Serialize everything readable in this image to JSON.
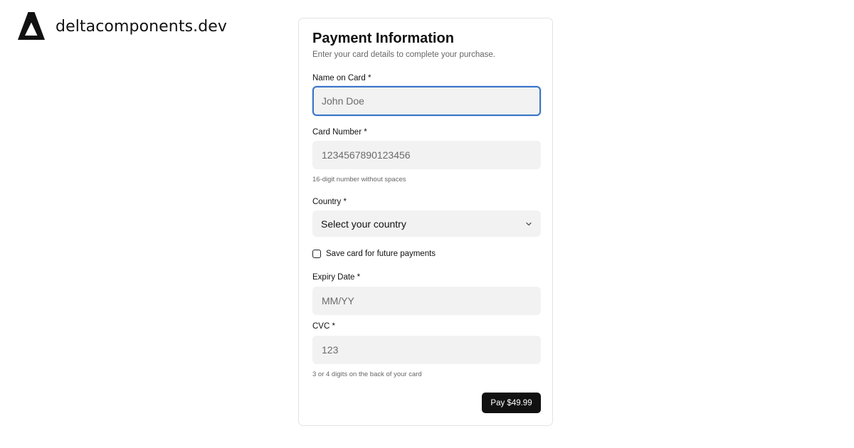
{
  "brand": {
    "name": "deltacomponents.dev",
    "logo_icon": "delta-triangle-icon"
  },
  "form": {
    "title": "Payment Information",
    "description": "Enter your card details to complete your purchase.",
    "name_on_card": {
      "label": "Name on Card *",
      "placeholder": "John Doe",
      "value": ""
    },
    "card_number": {
      "label": "Card Number *",
      "placeholder": "1234567890123456",
      "value": "",
      "hint": "16-digit number without spaces"
    },
    "country": {
      "label": "Country *",
      "selected": "Select your country",
      "icon": "chevron-down-icon"
    },
    "save_card": {
      "label": "Save card for future payments",
      "checked": false
    },
    "expiry": {
      "label": "Expiry Date *",
      "placeholder": "MM/YY",
      "value": ""
    },
    "cvc": {
      "label": "CVC *",
      "placeholder": "123",
      "value": "",
      "hint": "3 or 4 digits on the back of your card"
    },
    "submit_label": "Pay $49.99"
  },
  "colors": {
    "focus_ring": "#3a74c8",
    "button_bg": "#111111",
    "field_bg": "#f2f2f2"
  }
}
